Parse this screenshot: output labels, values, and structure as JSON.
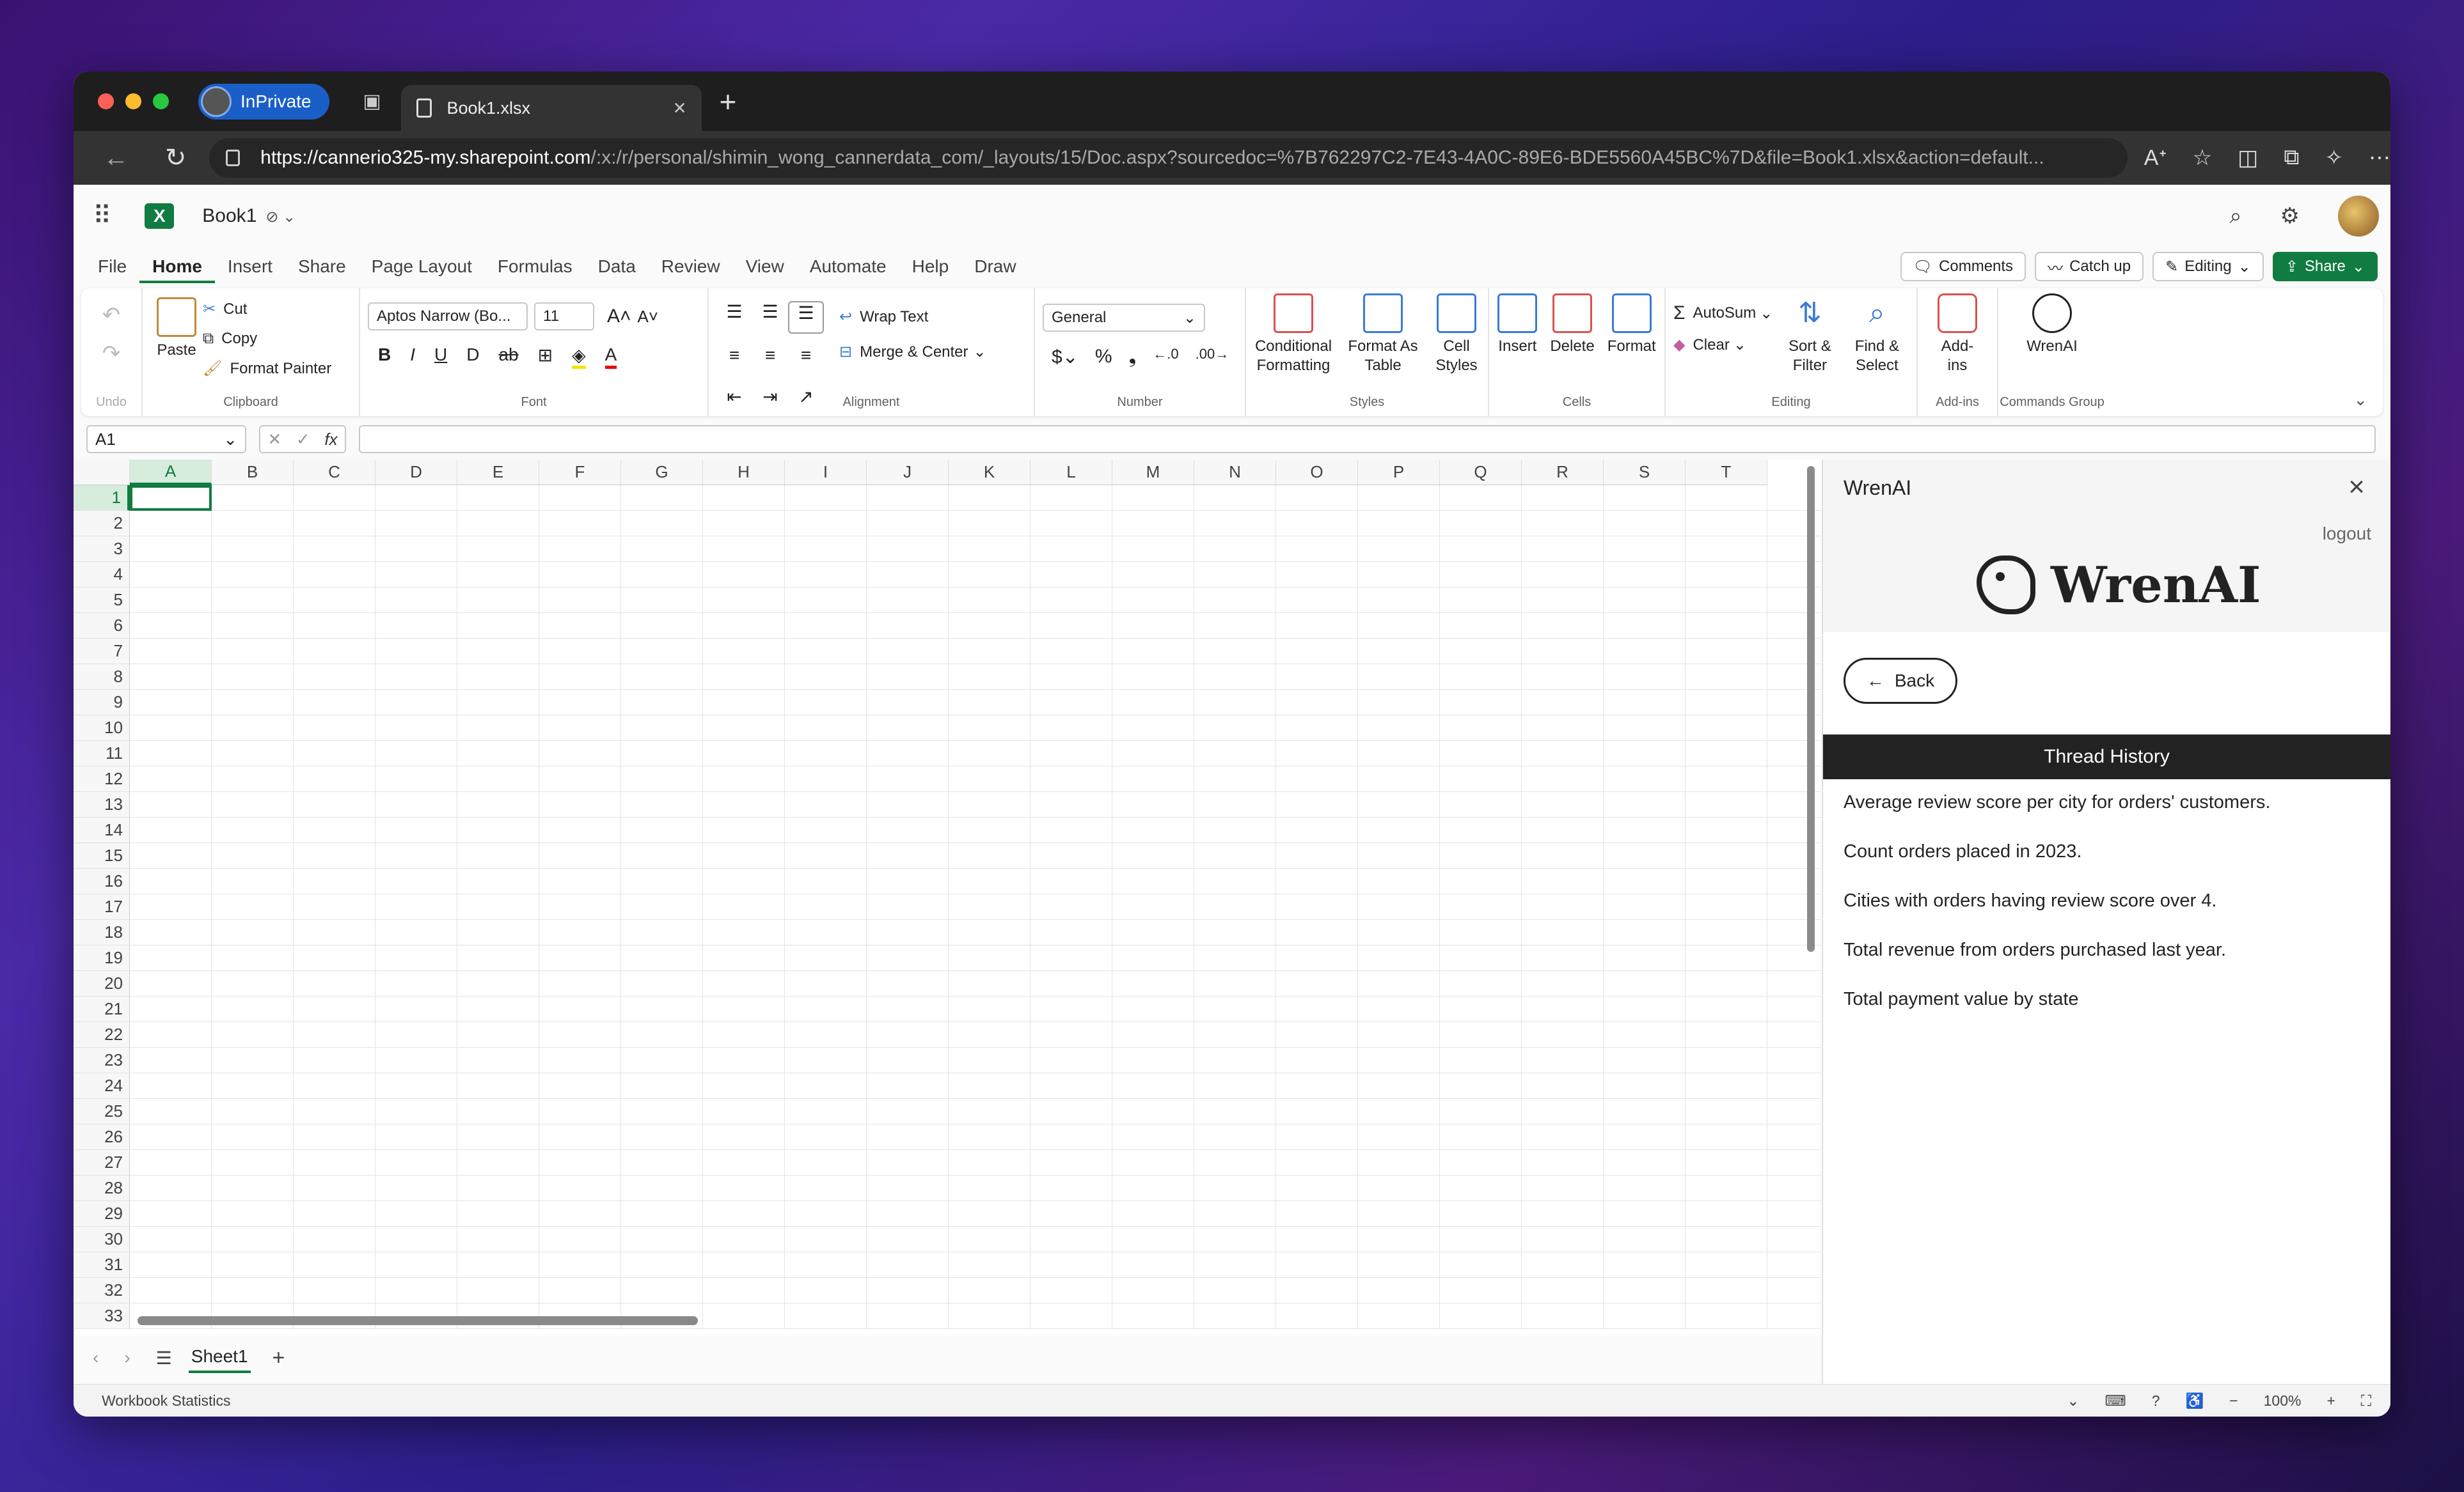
{
  "browser": {
    "inprivate_label": "InPrivate",
    "tab_title": "Book1.xlsx",
    "url_domain": "https://cannerio325-my.sharepoint.com",
    "url_path": "/:x:/r/personal/shimin_wong_cannerdata_com/_layouts/15/Doc.aspx?sourcedoc=%7B762297C2-7E43-4A0C-89E6-BDE5560A45BC%7D&file=Book1.xlsx&action=default..."
  },
  "app": {
    "workbook_name": "Book1"
  },
  "menu": {
    "items": [
      "File",
      "Home",
      "Insert",
      "Share",
      "Page Layout",
      "Formulas",
      "Data",
      "Review",
      "View",
      "Automate",
      "Help",
      "Draw"
    ],
    "active": "Home",
    "comments": "Comments",
    "catchup": "Catch up",
    "editing": "Editing",
    "share": "Share"
  },
  "ribbon": {
    "undo_group": "Undo",
    "clipboard": {
      "paste": "Paste",
      "cut": "Cut",
      "copy": "Copy",
      "format_painter": "Format Painter",
      "label": "Clipboard"
    },
    "font": {
      "name": "Aptos Narrow (Bo...",
      "size": "11",
      "label": "Font"
    },
    "alignment": {
      "wrap": "Wrap Text",
      "merge": "Merge & Center",
      "label": "Alignment"
    },
    "number": {
      "format": "General",
      "label": "Number"
    },
    "styles": {
      "conditional": "Conditional Formatting",
      "table": "Format As Table",
      "cell": "Cell Styles",
      "label": "Styles"
    },
    "cells": {
      "insert": "Insert",
      "delete": "Delete",
      "format": "Format",
      "label": "Cells"
    },
    "editing": {
      "autosum": "AutoSum",
      "clear": "Clear",
      "sort": "Sort & Filter",
      "find": "Find & Select",
      "label": "Editing"
    },
    "addins": {
      "addins": "Add-ins",
      "label": "Add-ins"
    },
    "commands": {
      "wrenai": "WrenAI",
      "label": "Commands Group"
    }
  },
  "formula_bar": {
    "cell_ref": "A1",
    "fx": "fx"
  },
  "grid": {
    "columns": [
      "A",
      "B",
      "C",
      "D",
      "E",
      "F",
      "G",
      "H",
      "I",
      "J",
      "K",
      "L",
      "M",
      "N",
      "O",
      "P",
      "Q",
      "R",
      "S",
      "T"
    ],
    "row_count": 33
  },
  "sheet_tab": "Sheet1",
  "status": {
    "left": "Workbook Statistics",
    "zoom": "100%"
  },
  "wrenai": {
    "title": "WrenAI",
    "logout": "logout",
    "brand": "WrenAI",
    "back": "Back",
    "thread_header": "Thread History",
    "threads": [
      "Average review score per city for orders' customers.",
      "Count orders placed in 2023.",
      "Cities with orders having review score over 4.",
      "Total revenue from orders purchased last year.",
      "Total payment value by state"
    ]
  },
  "colors": {
    "excel_green": "#107c41",
    "inprivate_blue": "#1a5fc8"
  }
}
